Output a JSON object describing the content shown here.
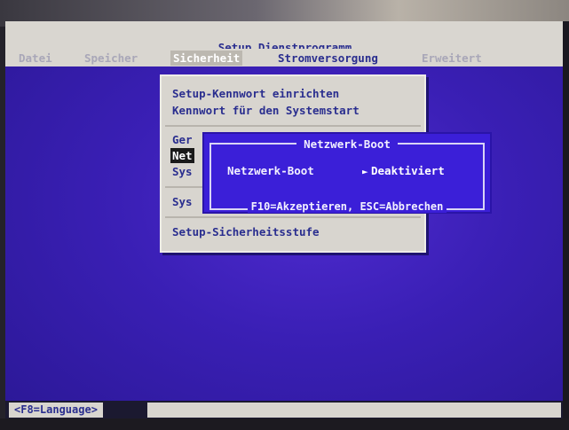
{
  "title": "Setup Dienstprogramm",
  "menu": {
    "datei": "Datei",
    "speicher": "Speicher",
    "sicherheit": "Sicherheit",
    "stromversorgung": "Stromversorgung",
    "erweitert": "Erweitert"
  },
  "dropdown": {
    "items": [
      "Setup-Kennwort einrichten",
      "Kennwort für den Systemstart",
      "Ger",
      "Net",
      "Sys",
      "Sys",
      "Setup-Sicherheitsstufe"
    ]
  },
  "dialog": {
    "title": "Netzwerk-Boot",
    "label": "Netzwerk-Boot",
    "value": "Deaktiviert",
    "pointer": "►",
    "help": "F10=Akzeptieren, ESC=Abbrechen"
  },
  "footer": {
    "language_key": "<F8=Language>"
  },
  "colors": {
    "screen_bg": "#3a1fb5",
    "menu_bg": "#d9d6d0",
    "menu_text": "#2a2e8f",
    "highlight": "#1a1a1a",
    "dialog_bg": "#3b1fd8"
  }
}
